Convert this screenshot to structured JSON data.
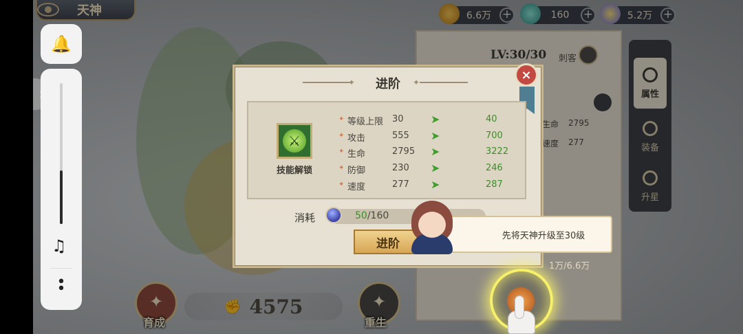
{
  "header": {
    "title": "天神",
    "resources": [
      {
        "value": "6.6万",
        "icon": "gold-coin-icon"
      },
      {
        "value": "160",
        "icon": "crystal-icon"
      },
      {
        "value": "5.2万",
        "icon": "potion-icon"
      }
    ]
  },
  "hero_panel": {
    "level": "LV:30/30",
    "role": "刺客",
    "stats": [
      {
        "name": "生命",
        "value": "2795"
      },
      {
        "name": "速度",
        "value": "277"
      }
    ],
    "cost_text": "1万/6.6万",
    "tabs": [
      "属性",
      "装备",
      "升星"
    ]
  },
  "bottom_bar": {
    "develop_label": "育成",
    "power": "4575",
    "rebirth_label": "重生"
  },
  "advance_dialog": {
    "title": "进阶",
    "close_glyph": "×",
    "skill_unlock_label": "技能解锁",
    "stats": [
      {
        "name": "等级上限",
        "current": "30",
        "next": "40"
      },
      {
        "name": "攻击",
        "current": "555",
        "next": "700"
      },
      {
        "name": "生命",
        "current": "2795",
        "next": "3222"
      },
      {
        "name": "防御",
        "current": "230",
        "next": "246"
      },
      {
        "name": "速度",
        "current": "277",
        "next": "287"
      }
    ],
    "cost_label": "消耗",
    "cost_have": "50",
    "cost_need": "/160",
    "advance_button": "进阶"
  },
  "guide": {
    "message": "先将天神升级至30级"
  },
  "system_panel": {
    "volume_level": 0.38
  }
}
